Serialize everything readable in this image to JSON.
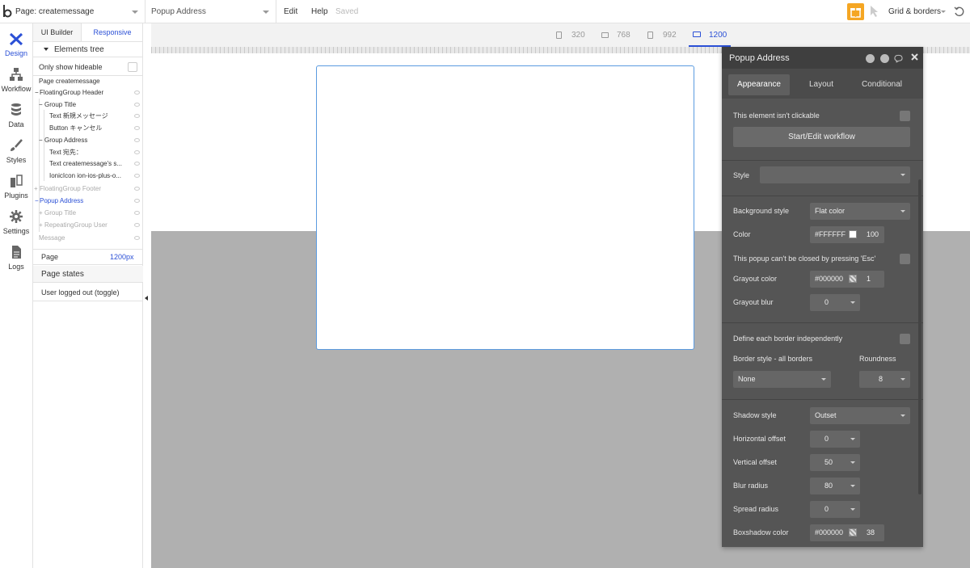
{
  "topbar": {
    "page_label": "Page: createmessage",
    "element_label": "Popup Address",
    "edit": "Edit",
    "help": "Help",
    "saved": "Saved",
    "grid": "Grid & borders"
  },
  "rail": [
    {
      "label": "Design",
      "icon": "design-icon"
    },
    {
      "label": "Workflow",
      "icon": "workflow-icon"
    },
    {
      "label": "Data",
      "icon": "database-icon"
    },
    {
      "label": "Styles",
      "icon": "brush-icon"
    },
    {
      "label": "Plugins",
      "icon": "plug-icon"
    },
    {
      "label": "Settings",
      "icon": "gear-icon"
    },
    {
      "label": "Logs",
      "icon": "document-icon"
    }
  ],
  "panel": {
    "tab_ui": "UI Builder",
    "tab_responsive": "Responsive",
    "tree_header": "Elements tree",
    "only_hide": "Only show hideable",
    "tree": [
      {
        "label": "Page createmessage"
      },
      {
        "label": "FloatingGroup Header"
      },
      {
        "label": "Group Title"
      },
      {
        "label": "Text 新規メッセージ"
      },
      {
        "label": "Button キャンセル"
      },
      {
        "label": "Group Address"
      },
      {
        "label": "Text 宛先："
      },
      {
        "label": "Text createmessage's s..."
      },
      {
        "label": "IonicIcon ion-ios-plus-o..."
      },
      {
        "label": "FloatingGroup Footer"
      },
      {
        "label": "Popup Address"
      },
      {
        "label": "Group Title"
      },
      {
        "label": "RepeatingGroup User"
      },
      {
        "label": "Message"
      }
    ],
    "page_label": "Page",
    "page_value": "1200px",
    "page_states": "Page states",
    "state_row": "User logged out (toggle)"
  },
  "devices": [
    {
      "label": "320"
    },
    {
      "label": "768"
    },
    {
      "label": "992"
    },
    {
      "label": "1200"
    }
  ],
  "prop": {
    "title": "Popup Address",
    "tabs": {
      "appearance": "Appearance",
      "layout": "Layout",
      "conditional": "Conditional"
    },
    "not_clickable": "This element isn't clickable",
    "start_workflow": "Start/Edit workflow",
    "style_label": "Style",
    "bg_style_label": "Background style",
    "bg_style_value": "Flat color",
    "color_label": "Color",
    "color_hex": "#FFFFFF",
    "color_opacity": "100",
    "esc_label": "This popup can't be closed by pressing 'Esc'",
    "grayout_color_label": "Grayout color",
    "grayout_hex": "#000000",
    "grayout_opacity": "1",
    "grayout_blur_label": "Grayout blur",
    "grayout_blur_value": "0",
    "border_indep_label": "Define each border independently",
    "border_style_label": "Border style - all borders",
    "roundness_label": "Roundness",
    "border_style_value": "None",
    "roundness_value": "8",
    "shadow_style_label": "Shadow style",
    "shadow_style_value": "Outset",
    "h_offset_label": "Horizontal offset",
    "h_offset_value": "0",
    "v_offset_label": "Vertical offset",
    "v_offset_value": "50",
    "blur_label": "Blur radius",
    "blur_value": "80",
    "spread_label": "Spread radius",
    "spread_value": "0",
    "bs_color_label": "Boxshadow color",
    "bs_hex": "#000000",
    "bs_opacity": "38"
  },
  "colors": {
    "accent": "#2b50d6",
    "panel": "#555555",
    "gift": "#f5a623"
  }
}
